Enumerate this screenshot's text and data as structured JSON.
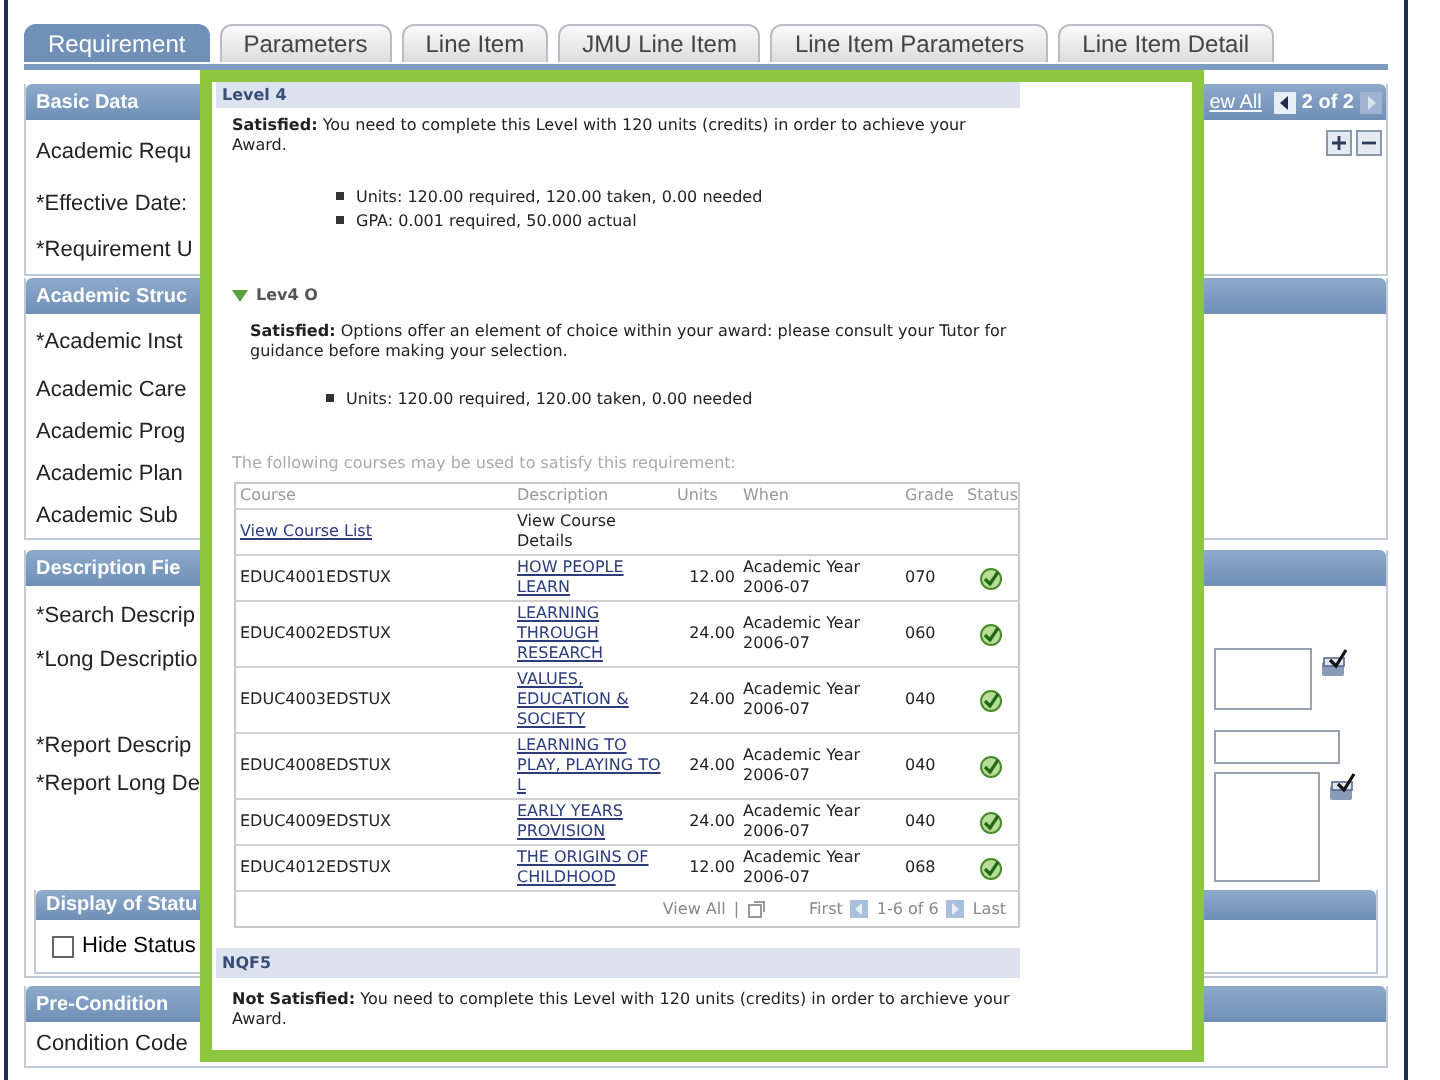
{
  "tabs": [
    {
      "label": "Requirement",
      "selected": true
    },
    {
      "label": "Parameters",
      "selected": false
    },
    {
      "label": "Line Item",
      "selected": false
    },
    {
      "label": "JMU Line Item",
      "selected": false
    },
    {
      "label": "Line Item Parameters",
      "selected": false
    },
    {
      "label": "Line Item Detail",
      "selected": false
    }
  ],
  "sections": [
    {
      "title": "Basic Data",
      "view_all": "ew All",
      "counter": "2 of 2",
      "rows": [
        {
          "label": "Academic Requ",
          "kind": "label"
        },
        {
          "label": "*Effective Date:",
          "kind": "label"
        },
        {
          "label": "*Requirement U",
          "kind": "label"
        }
      ]
    },
    {
      "title": "Academic Struc",
      "rows": [
        {
          "label": "*Academic Inst",
          "kind": "label"
        },
        {
          "label": "Academic Care",
          "kind": "label"
        },
        {
          "label": "Academic Prog",
          "kind": "label"
        },
        {
          "label": "Academic Plan",
          "kind": "label"
        },
        {
          "label": "Academic Sub",
          "kind": "label"
        }
      ]
    },
    {
      "title": "Description Fie",
      "rows": [
        {
          "label": "*Search Descrip",
          "kind": "label"
        },
        {
          "label": "*Long Descriptio",
          "kind": "textarea"
        },
        {
          "label": "*Report Descrip",
          "kind": "input"
        },
        {
          "label": "*Report Long De",
          "kind": "textarea"
        }
      ],
      "subsection": {
        "title": "Display of Statu",
        "checkbox": {
          "label": "Hide Status",
          "checked": false
        }
      }
    },
    {
      "title": "Pre-Condition",
      "rows": [
        {
          "label": "Condition Code",
          "kind": "label"
        }
      ]
    }
  ],
  "popup": {
    "level": {
      "title": "Level 4",
      "message": "**Satisfied:** You need to complete this Level with 120 units (credits) in order to achieve your Award.",
      "bullets": [
        "Units: 120.00 required, 120.00 taken, 0.00 needed",
        "GPA: 0.001 required, 50.000 actual"
      ]
    },
    "sublevel": {
      "title": "Lev4 O",
      "expanded": true,
      "message": "**Satisfied:** Options offer an element of choice within your award: please consult your Tutor for guidance before making your selection.",
      "bullets": [
        "Units: 120.00 required, 120.00 taken, 0.00 needed"
      ]
    },
    "courses_intro": "The following courses may be used to satisfy this requirement:",
    "table": {
      "columns": [
        "Course",
        "Description",
        "Units",
        "When",
        "Grade",
        "Status"
      ],
      "rows": [
        {
          "kind": "links",
          "course": "View Course List",
          "description": "View Course Details"
        },
        {
          "kind": "course",
          "course": "EDUC4001EDSTUX",
          "description": "HOW PEOPLE LEARN",
          "units": "12.00",
          "when": "Academic Year 2006-07",
          "grade": "070",
          "satisfied": true
        },
        {
          "kind": "course",
          "course": "EDUC4002EDSTUX",
          "description": "LEARNING THROUGH RESEARCH",
          "units": "24.00",
          "when": "Academic Year 2006-07",
          "grade": "060",
          "satisfied": true
        },
        {
          "kind": "course",
          "course": "EDUC4003EDSTUX",
          "description": "VALUES, EDUCATION & SOCIETY",
          "units": "24.00",
          "when": "Academic Year 2006-07",
          "grade": "040",
          "satisfied": true
        },
        {
          "kind": "course",
          "course": "EDUC4008EDSTUX",
          "description": "LEARNING TO PLAY, PLAYING TO L",
          "units": "24.00",
          "when": "Academic Year 2006-07",
          "grade": "040",
          "satisfied": true
        },
        {
          "kind": "course",
          "course": "EDUC4009EDSTUX",
          "description": "EARLY YEARS PROVISION",
          "units": "24.00",
          "when": "Academic Year 2006-07",
          "grade": "040",
          "satisfied": true
        },
        {
          "kind": "course",
          "course": "EDUC4012EDSTUX",
          "description": "THE ORIGINS OF CHILDHOOD",
          "units": "12.00",
          "when": "Academic Year 2006-07",
          "grade": "068",
          "satisfied": true
        }
      ],
      "footer": {
        "view_all": "View All",
        "separator": "|",
        "first": "First",
        "range": "1-6 of 6",
        "last": "Last"
      }
    },
    "next_level": {
      "title": "NQF5",
      "message": "**Not Satisfied:** You need to complete this Level with 120 units (credits) in order to archieve your Award."
    }
  }
}
